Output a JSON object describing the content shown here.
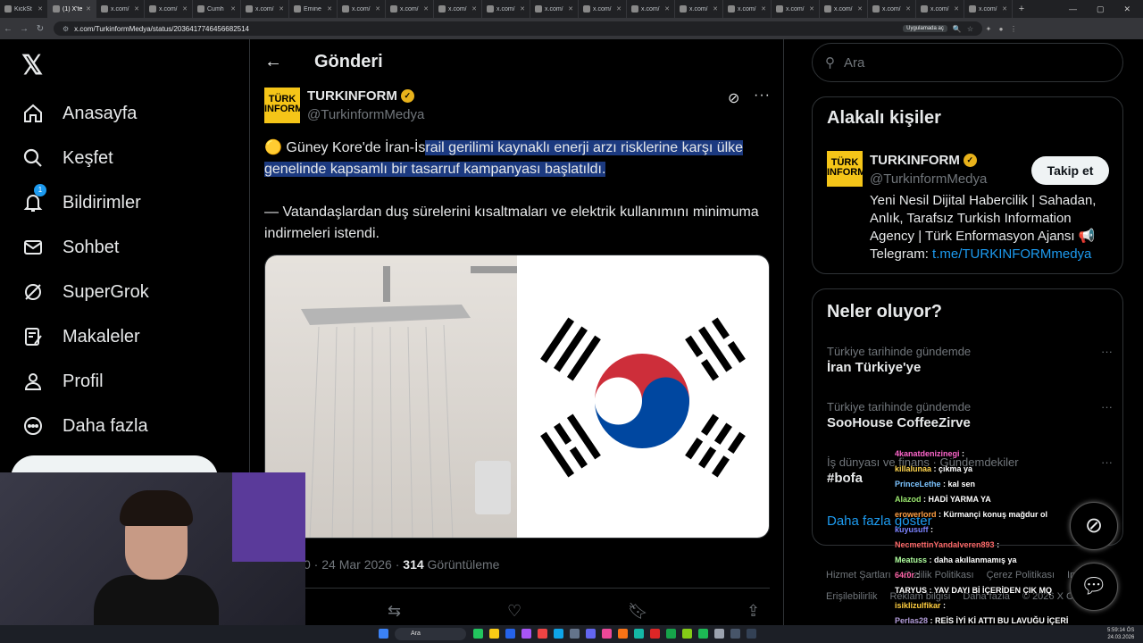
{
  "browser": {
    "tabs": [
      {
        "title": "KickSt",
        "active": false
      },
      {
        "title": "(1) X'te",
        "active": true
      },
      {
        "title": "x.com/",
        "active": false
      },
      {
        "title": "x.com/",
        "active": false
      },
      {
        "title": "Cumh",
        "active": false
      },
      {
        "title": "x.com/",
        "active": false
      },
      {
        "title": "Emine",
        "active": false
      },
      {
        "title": "x.com/",
        "active": false
      },
      {
        "title": "x.com/",
        "active": false
      },
      {
        "title": "x.com/",
        "active": false
      },
      {
        "title": "x.com/",
        "active": false
      },
      {
        "title": "x.com/",
        "active": false
      },
      {
        "title": "x.com/",
        "active": false
      },
      {
        "title": "x.com/",
        "active": false
      },
      {
        "title": "x.com/",
        "active": false
      },
      {
        "title": "x.com/",
        "active": false
      },
      {
        "title": "x.com/",
        "active": false
      },
      {
        "title": "x.com/",
        "active": false
      },
      {
        "title": "x.com/",
        "active": false
      },
      {
        "title": "x.com/",
        "active": false
      },
      {
        "title": "x.com/",
        "active": false
      }
    ],
    "url": "x.com/TurkinformMedya/status/2036417746456682514",
    "app_chip": "Uygulamada aç"
  },
  "nav": {
    "items": [
      {
        "label": "Anasayfa",
        "icon": "home-icon"
      },
      {
        "label": "Keşfet",
        "icon": "search-icon"
      },
      {
        "label": "Bildirimler",
        "icon": "bell-icon",
        "badge": "1"
      },
      {
        "label": "Sohbet",
        "icon": "mail-icon"
      },
      {
        "label": "SuperGrok",
        "icon": "grok-icon"
      },
      {
        "label": "Makaleler",
        "icon": "article-icon"
      },
      {
        "label": "Profil",
        "icon": "person-icon"
      },
      {
        "label": "Daha fazla",
        "icon": "more-circle-icon"
      }
    ]
  },
  "post": {
    "header": "Gönderi",
    "author_name": "TURKINFORM",
    "author_handle": "@TurkinformMedya",
    "avatar_text": "TÜRK INFORM",
    "text_emoji": "🟡",
    "text_pre": " Güney Kore'de İran-İs",
    "text_highlight": "rail gerilimi kaynaklı enerji arzı risklerine karşı ülke genelinde kapsamlı bir tasarruf kampanyası başlatıldı.",
    "text_para2": "— Vatandaşlardan duş sürelerini kısaltmaları ve elektrik kullanımını minimuma indirmeleri istendi.",
    "meta_prefix": "0 · 24 Mar 2026 · ",
    "views_count": "314",
    "views_label": " Görüntüleme"
  },
  "right": {
    "search_placeholder": "Ara",
    "related_title": "Alakalı kişiler",
    "related_name": "TURKINFORM",
    "related_handle": "@TurkinformMedya",
    "follow_label": "Takip et",
    "bio_text": "Yeni Nesil Dijital Habercilik | Sahadan, Anlık, Tarafsız Turkish Information Agency | Türk Enformasyon Ajansı 📢 Telegram: ",
    "bio_link": "t.me/TURKINFORMmedya",
    "trends_title": "Neler oluyor?",
    "trends": [
      {
        "context": "Türkiye tarihinde gündemde",
        "name": "İran Türkiye'ye"
      },
      {
        "context": "Türkiye tarihinde gündemde",
        "name": "SooHouse CoffeeZirve"
      },
      {
        "context": "İş dünyası ve finans · Gündemdekiler",
        "name": "#bofa"
      }
    ],
    "show_more": "Daha fazla göster",
    "footer": [
      "Hizmet Şartları",
      "Gizlilik Politikası",
      "Çerez Politikası",
      "Imprint",
      "Erişilebilirlik",
      "Reklam bilgisi",
      "Daha fazla",
      "© 2026 X Corp."
    ]
  },
  "chat": [
    {
      "user": "4kanatdenizinegi",
      "msg": ""
    },
    {
      "user": "killalunaa",
      "msg": "çıkma ya"
    },
    {
      "user": "PrinceLethe",
      "msg": "kal sen"
    },
    {
      "user": "Alazod",
      "msg": "HADİ YARMA YA"
    },
    {
      "user": "erowerlord",
      "msg": "Kürmançi konuş mağdur ol"
    },
    {
      "user": "kuyusuff",
      "msg": ""
    },
    {
      "user": "NecmettinYandalveren893",
      "msg": ""
    },
    {
      "user": "Meatuss",
      "msg": "daha akıllanmamış ya"
    },
    {
      "user": "64r0r",
      "msg": ""
    },
    {
      "user": "TARYUS",
      "msg": "YAV DAYI Bİ İÇERİDEN ÇIK MQ"
    },
    {
      "user": "isiklizulfikar",
      "msg": ""
    },
    {
      "user": "Perlas28",
      "msg": "REİS İYİ Kİ ATTI BU LAVUĞU İÇERİ"
    }
  ],
  "taskbar": {
    "search": "Ara",
    "time": "5:59:14 ÖS",
    "date": "24.03.2026"
  }
}
